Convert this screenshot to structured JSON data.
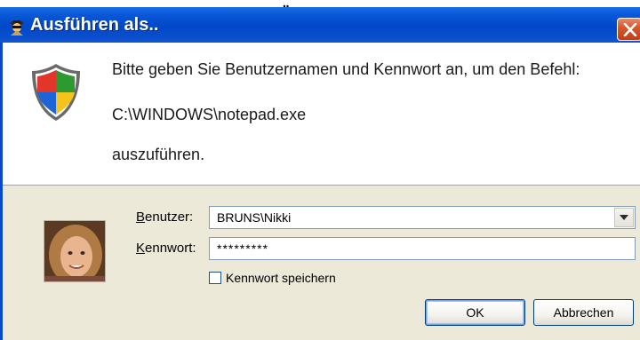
{
  "window": {
    "title": "Ausführen als..",
    "top_fragment_text": "„"
  },
  "prompt": {
    "line1": "Bitte geben Sie Benutzernamen und Kennwort an, um den Befehl:",
    "path": "C:\\WINDOWS\\notepad.exe",
    "line3": "auszuführen."
  },
  "form": {
    "user_label_accel": "B",
    "user_label_rest": "enutzer:",
    "user_value": "BRUNS\\Nikki",
    "password_label_accel": "K",
    "password_label_rest": "ennwort:",
    "password_value": "*********",
    "save_password_label": "Kennwort speichern",
    "save_password_checked": false
  },
  "buttons": {
    "ok": "OK",
    "cancel": "Abbrechen"
  },
  "colors": {
    "titlebar": "#0048c8",
    "dialog_bg": "#ece9d8",
    "close_button": "#c43d14"
  }
}
